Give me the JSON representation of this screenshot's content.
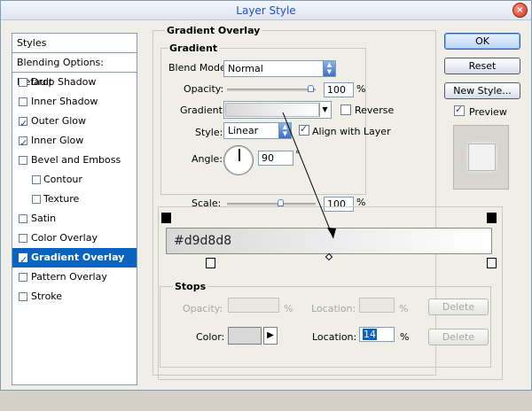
{
  "window": {
    "title": "Layer Style",
    "close_label": "×"
  },
  "sidebar": {
    "header": "Styles",
    "blending": "Blending Options: Default",
    "items": [
      {
        "label": "Drop Shadow",
        "checked": false
      },
      {
        "label": "Inner Shadow",
        "checked": false
      },
      {
        "label": "Outer Glow",
        "checked": true
      },
      {
        "label": "Inner Glow",
        "checked": true
      },
      {
        "label": "Bevel and Emboss",
        "checked": false
      },
      {
        "label": "Contour",
        "checked": false
      },
      {
        "label": "Texture",
        "checked": false
      },
      {
        "label": "Satin",
        "checked": false
      },
      {
        "label": "Color Overlay",
        "checked": false
      },
      {
        "label": "Gradient Overlay",
        "checked": true
      },
      {
        "label": "Pattern Overlay",
        "checked": false
      },
      {
        "label": "Stroke",
        "checked": false
      }
    ]
  },
  "buttons": {
    "ok": "OK",
    "reset": "Reset",
    "new_style": "New Style...",
    "preview": "Preview"
  },
  "gradient_overlay": {
    "section_title": "Gradient Overlay",
    "group_title": "Gradient",
    "blend_mode_label": "Blend Mode:",
    "blend_mode_value": "Normal",
    "opacity_label": "Opacity:",
    "opacity_value": "100",
    "opacity_unit": "%",
    "opacity_level": 1.0,
    "gradient_label": "Gradient:",
    "reverse_label": "Reverse",
    "style_label": "Style:",
    "style_value": "Linear",
    "align_label": "Align with Layer",
    "angle_label": "Angle:",
    "angle_value": "90",
    "angle_unit": "°",
    "scale_label": "Scale:",
    "scale_value": "100",
    "scale_unit": "%",
    "scale_level": 0.67
  },
  "editor": {
    "gradient_text": "#d9d8d8",
    "stops_title": "Stops",
    "opacity_label": "Opacity:",
    "opacity_unit": "%",
    "location_label": "Location:",
    "location_unit": "%",
    "delete_label": "Delete",
    "color_label": "Color:",
    "color_location_label": "Location:",
    "color_location_value": "14",
    "color_location_unit": "%",
    "color_delete_label": "Delete"
  },
  "colors": {
    "selected_row": "#0a64bf",
    "gradient_left": "#d9d8d8",
    "gradient_right": "#ffffff",
    "stop_color": "#d9d8d8"
  }
}
